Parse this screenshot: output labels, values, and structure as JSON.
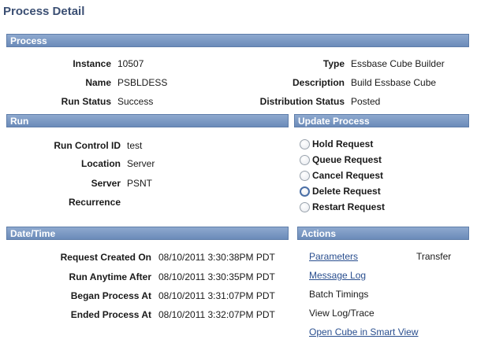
{
  "page": {
    "title": "Process Detail"
  },
  "process": {
    "header": "Process",
    "instance_label": "Instance",
    "instance_value": "10507",
    "name_label": "Name",
    "name_value": "PSBLDESS",
    "run_status_label": "Run Status",
    "run_status_value": "Success",
    "type_label": "Type",
    "type_value": "Essbase Cube Builder",
    "description_label": "Description",
    "description_value": "Build Essbase Cube",
    "dist_status_label": "Distribution Status",
    "dist_status_value": "Posted"
  },
  "run": {
    "header": "Run",
    "run_control_label": "Run Control ID",
    "run_control_value": "test",
    "location_label": "Location",
    "location_value": "Server",
    "server_label": "Server",
    "server_value": "PSNT",
    "recurrence_label": "Recurrence"
  },
  "update_process": {
    "header": "Update Process",
    "options": [
      "Hold Request",
      "Queue Request",
      "Cancel Request",
      "Delete Request",
      "Restart Request"
    ]
  },
  "datetime": {
    "header": "Date/Time",
    "created_label": "Request Created On",
    "created_value": "08/10/2011  3:30:38PM PDT",
    "anytime_label": "Run Anytime After",
    "anytime_value": "08/10/2011  3:30:35PM PDT",
    "began_label": "Began Process At",
    "began_value": "08/10/2011  3:31:07PM PDT",
    "ended_label": "Ended Process At",
    "ended_value": "08/10/2011  3:32:07PM PDT"
  },
  "actions": {
    "header": "Actions",
    "parameters": "Parameters",
    "transfer": "Transfer",
    "message_log": "Message Log",
    "batch_timings": "Batch Timings",
    "view_log": "View Log/Trace",
    "open_cube": "Open Cube in Smart View"
  },
  "colors": {
    "header_bg": "#7a98c4",
    "link": "#2a4f8f",
    "title": "#3b4f73"
  }
}
